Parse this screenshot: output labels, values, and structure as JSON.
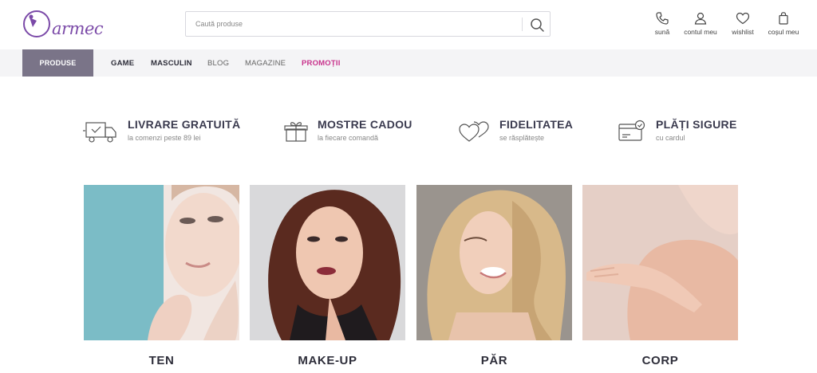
{
  "brand": {
    "logo_text": "armec",
    "accent": "#7b4aa8"
  },
  "search": {
    "placeholder": "Caută produse",
    "icon": "search-icon"
  },
  "header_actions": [
    {
      "label": "sună",
      "icon": "phone-icon"
    },
    {
      "label": "contul meu",
      "icon": "user-icon"
    },
    {
      "label": "wishlist",
      "icon": "heart-icon"
    },
    {
      "label": "coșul meu",
      "icon": "bag-icon"
    }
  ],
  "nav": {
    "produse": "PRODUSE",
    "items": [
      "GAME",
      "MASCULIN",
      "BLOG",
      "MAGAZINE",
      "PROMOȚII"
    ],
    "active_color": "#7a7488",
    "promo_color": "#c8338c"
  },
  "benefits": [
    {
      "title": "LIVRARE GRATUITĂ",
      "subtitle": "la comenzi peste 89 lei",
      "icon": "delivery-truck-icon"
    },
    {
      "title": "MOSTRE CADOU",
      "subtitle": "la fiecare comandă",
      "icon": "gift-box-icon"
    },
    {
      "title": "FIDELITATEA",
      "subtitle": "se răsplătește",
      "icon": "hearts-icon"
    },
    {
      "title": "PLĂȚI SIGURE",
      "subtitle": "cu cardul",
      "icon": "secure-card-icon"
    }
  ],
  "categories": [
    {
      "label": "TEN",
      "bg": "#7bbcc6"
    },
    {
      "label": "MAKE-UP",
      "bg": "#d9d9db"
    },
    {
      "label": "PĂR",
      "bg": "#9a948e"
    },
    {
      "label": "CORP",
      "bg": "#e5cfc6"
    }
  ]
}
